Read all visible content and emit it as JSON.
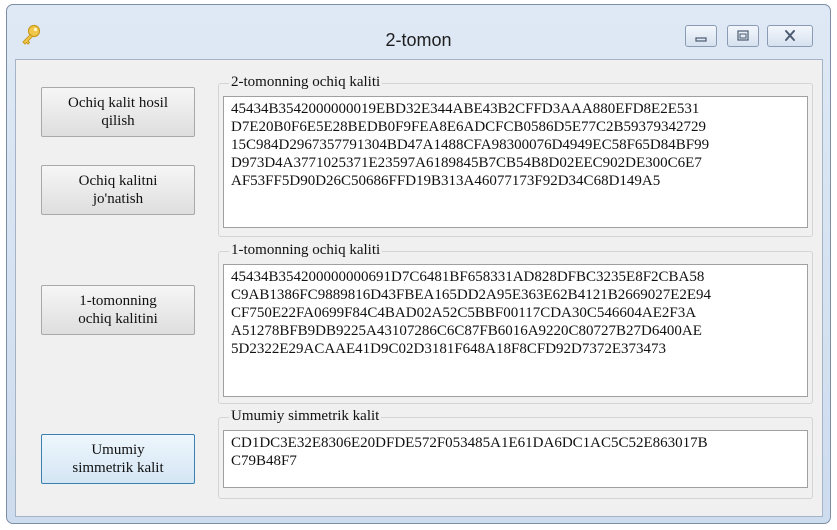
{
  "window": {
    "title": "2-tomon"
  },
  "buttons": {
    "generate": "Ochiq kalit hosil\nqilish",
    "send": "Ochiq kalitni\njo'natish",
    "receive": "1-tomonning\nochiq kalitini",
    "shared": "Umumiy\nsimmetrik kalit"
  },
  "groups": {
    "side2_public": {
      "label": "2-tomonning ochiq kaliti",
      "value": "45434B3542000000019EBD32E344ABE43B2CFFD3AAA880EFD8E2E531\nD7E20B0F6E5E28BEDB0F9FEA8E6ADCFCB0586D5E77C2B59379342729\n15C984D2967357791304BD47A1488CFA98300076D4949EC58F65D84BF99\nD973D4A3771025371E23597A6189845B7CB54B8D02EEC902DE300C6E7\nAF53FF5D90D26C50686FFD19B313A46077173F92D34C68D149A5"
    },
    "side1_public": {
      "label": "1-tomonning ochiq kaliti",
      "value": "45434B354200000000691D7C6481BF658331AD828DFBC3235E8F2CBA58\nC9AB1386FC9889816D43FBEA165DD2A95E363E62B4121B2669027E2E94\nCF750E22FA0699F84C4BAD02A52C5BBF00117CDA30C546604AE2F3A\nA51278BFB9DB9225A43107286C6C87FB6016A9220C80727B27D6400AE\n5D2322E29ACAAE41D9C02D3181F648A18F8CFD92D7372E373473"
    },
    "shared_key": {
      "label": "Umumiy simmetrik kalit",
      "value": "CD1DC3E32E8306E20DFDE572F053485A1E61DA6DC1AC5C52E863017B\nC79B48F7"
    }
  }
}
